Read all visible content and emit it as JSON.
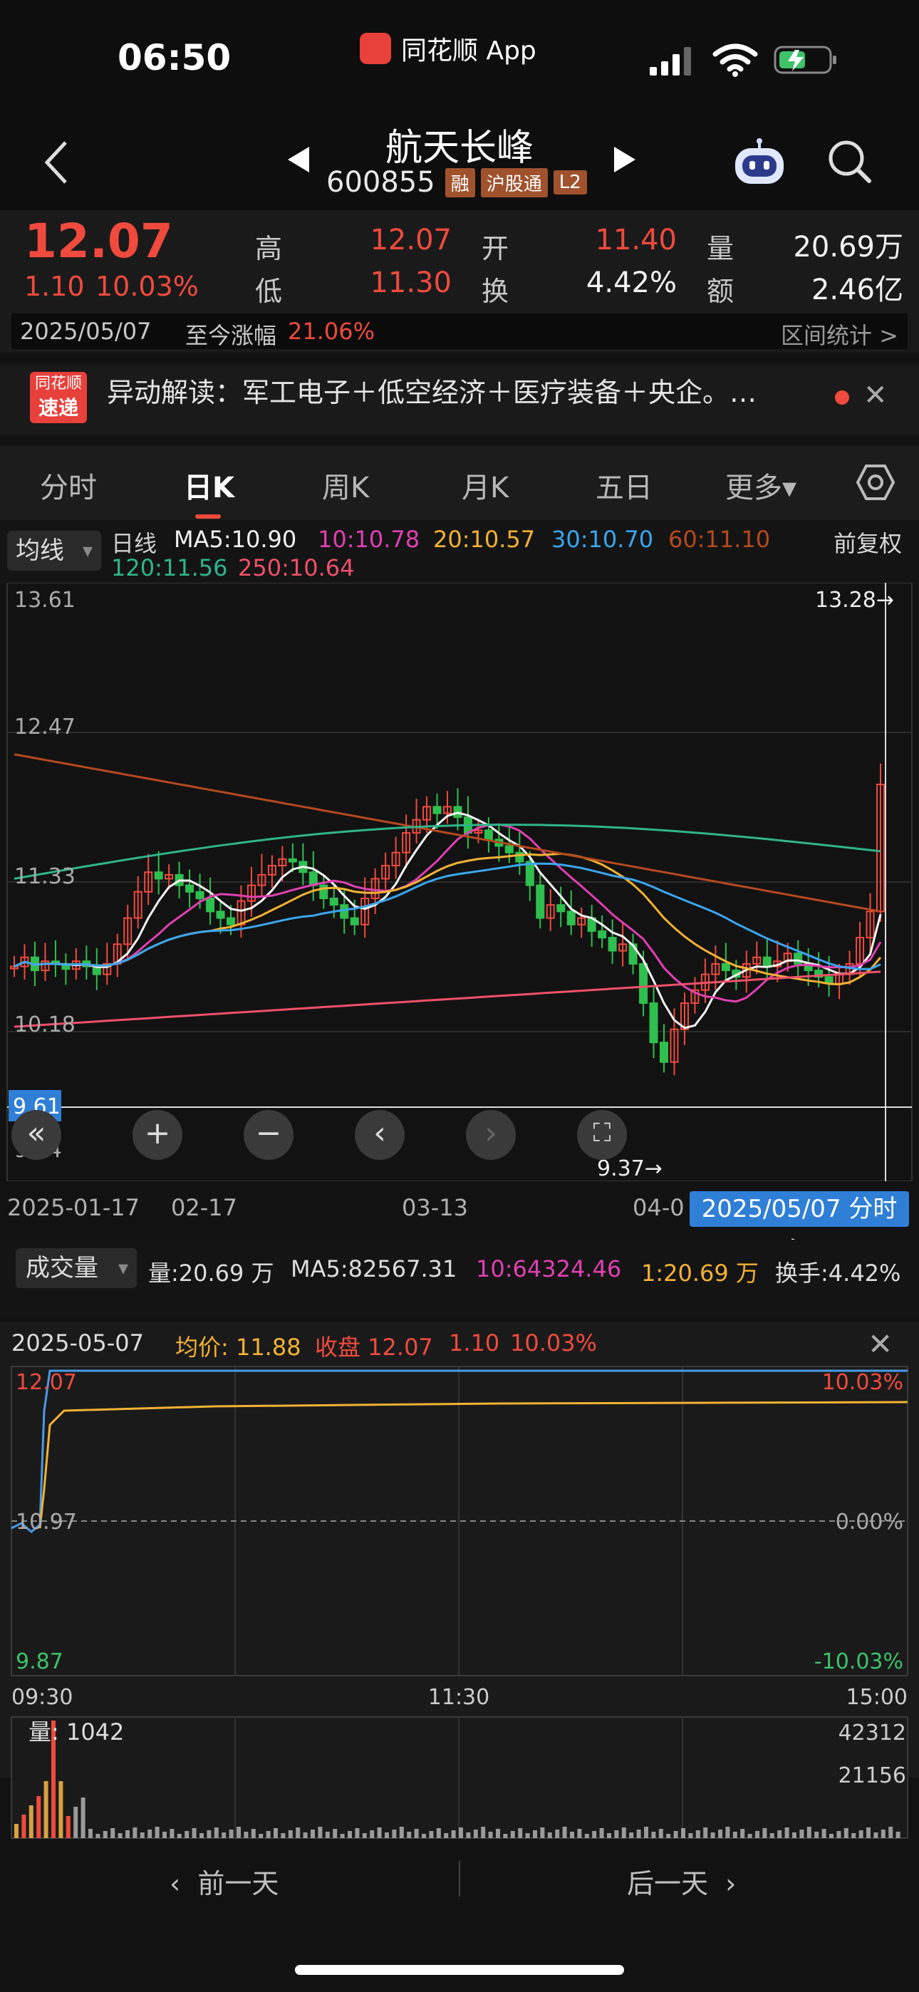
{
  "status": {
    "time": "06:50",
    "app_name": "同花顺 App"
  },
  "nav": {
    "stock_name": "航天长峰",
    "stock_code": "600855",
    "badges": [
      "融",
      "沪股通",
      "L2"
    ]
  },
  "quote": {
    "price": "12.07",
    "change": "1.10",
    "change_pct": "10.03%",
    "high_label": "高",
    "high": "12.07",
    "low_label": "低",
    "low": "11.30",
    "open_label": "开",
    "open": "11.40",
    "turnover_label": "换",
    "turnover": "4.42%",
    "volume_label": "量",
    "volume": "20.69万",
    "amount_label": "额",
    "amount": "2.46亿",
    "date": "2025/05/07",
    "cum_label": "至今涨幅",
    "cum_value": "21.06%",
    "range_stats": "区间统计 >"
  },
  "news": {
    "logo_line1": "同花顺",
    "logo_line2": "速递",
    "text": "异动解读：军工电子＋低空经济＋医疗装备＋央企。…"
  },
  "tabs": [
    "分时",
    "日K",
    "周K",
    "月K",
    "五日",
    "更多▾"
  ],
  "ma_legend": {
    "dropdown": "均线",
    "period": "日线",
    "ma5": "MA5:10.90",
    "ma10": "10:10.78",
    "ma20": "20:10.57",
    "ma30": "30:10.70",
    "ma60": "60:11.10",
    "ma120": "120:11.56",
    "ma250": "250:10.64",
    "adjust": "前复权"
  },
  "colors": {
    "ma5": "#f2f2f2",
    "ma10": "#e040b0",
    "ma20": "#f3b233",
    "ma30": "#3aa6f0",
    "ma60": "#b5491e",
    "ma120": "#2fb58a",
    "ma250": "#f0506a",
    "up": "#f04a3e",
    "down": "#2fbf4f"
  },
  "chart_data": {
    "type": "candlestick",
    "y_axis_labels": [
      "13.61",
      "12.47",
      "11.33",
      "10.18",
      "9.04"
    ],
    "current_price_label": "9.61",
    "high_marker": "13.28→",
    "low_marker": "9.37→",
    "x_axis_labels": [
      "2025-01-17",
      "02-17",
      "03-13",
      "04-0"
    ],
    "selected_date": "2025/05/07 分时 >"
  },
  "volume_legend": {
    "dropdown": "成交量",
    "vol": "量:20.69 万",
    "ma5": "MA5:82567.31",
    "ma10": "10:64324.46",
    "ma1": "1:20.69 万",
    "turnover": "换手:4.42%"
  },
  "intraday": {
    "date": "2025-05-07",
    "avg_label": "均价: 11.88",
    "close_label": "收盘 12.07",
    "change": "1.10",
    "change_pct": "10.03%",
    "y_top": "12.07",
    "y_mid": "10.97",
    "y_bottom": "9.87",
    "pct_top": "10.03%",
    "pct_mid": "0.00%",
    "pct_bottom": "-10.03%",
    "t_start": "09:30",
    "t_mid": "11:30",
    "t_end": "15:00",
    "vol_label": "量: 1042",
    "vol_max": "42312",
    "vol_half": "21156"
  },
  "bottom": {
    "prev": "前一天",
    "next": "后一天"
  }
}
